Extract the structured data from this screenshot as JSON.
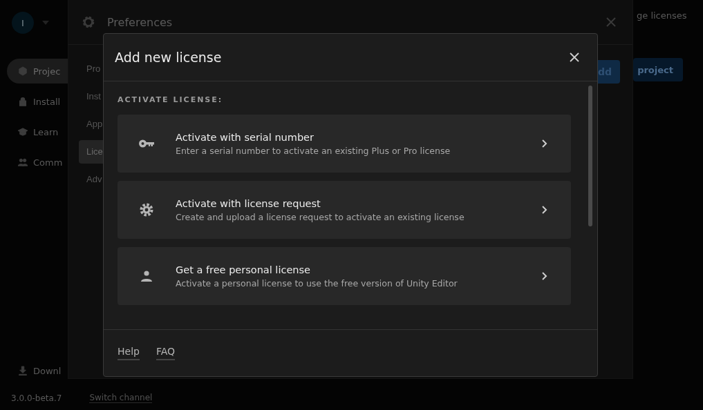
{
  "app": {
    "avatar": "I",
    "nav": [
      {
        "label": "Projec",
        "selected": true
      },
      {
        "label": "Install",
        "selected": false
      },
      {
        "label": "Learn",
        "selected": false
      },
      {
        "label": "Comm",
        "selected": false
      }
    ],
    "downloads": "Downl",
    "version": "3.0.0-beta.7",
    "switch_channel": "Switch channel",
    "manage_licenses": "ge licenses",
    "add_button": "dd",
    "new_project_button": "project"
  },
  "preferences": {
    "title": "Preferences",
    "nav": [
      {
        "label": "Pro",
        "selected": false
      },
      {
        "label": "Inst",
        "selected": false
      },
      {
        "label": "App",
        "selected": false
      },
      {
        "label": "Lice",
        "selected": true
      },
      {
        "label": "Adv",
        "selected": false
      }
    ]
  },
  "dialog": {
    "title": "Add new license",
    "section_label": "ACTIVATE LICENSE:",
    "options": [
      {
        "title": "Activate with serial number",
        "description": "Enter a serial number to activate an existing Plus or Pro license"
      },
      {
        "title": "Activate with license request",
        "description": "Create and upload a license request to activate an existing license"
      },
      {
        "title": "Get a free personal license",
        "description": "Activate a personal license to use the free version of Unity Editor"
      }
    ],
    "footer_links": [
      "Help",
      "FAQ"
    ]
  }
}
